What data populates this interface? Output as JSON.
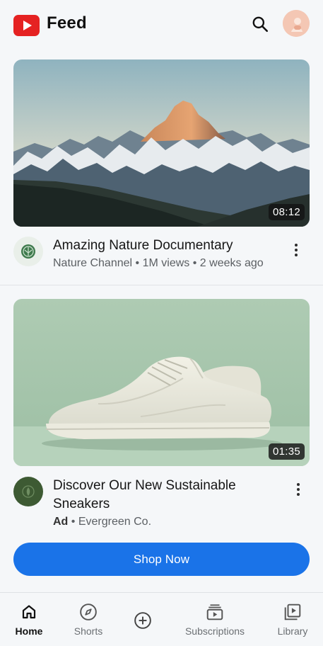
{
  "header": {
    "title": "Feed",
    "logo_icon": "youtube-play-icon",
    "search_icon": "search-icon",
    "avatar_icon": "user-avatar-icon"
  },
  "feed": [
    {
      "title": "Amazing Nature Documentary",
      "channel": "Nature Channel",
      "views": "1M views",
      "age": "2 weeks ago",
      "duration": "08:12",
      "thumbnail": "mountain-landscape"
    },
    {
      "title": "Discover Our New Sustainable Sneakers",
      "ad_label": "Ad",
      "advertiser": "Evergreen Co.",
      "duration": "01:35",
      "thumbnail": "white-sneaker",
      "cta": "Shop Now"
    }
  ],
  "separator": "•",
  "nav": [
    {
      "label": "Home",
      "icon": "home-icon",
      "active": true
    },
    {
      "label": "Shorts",
      "icon": "compass-icon",
      "active": false
    },
    {
      "label": "",
      "icon": "add-icon",
      "active": false
    },
    {
      "label": "Subscriptions",
      "icon": "subscriptions-icon",
      "active": false
    },
    {
      "label": "Library",
      "icon": "library-icon",
      "active": false
    }
  ],
  "colors": {
    "brand_red": "#e52222",
    "accent_blue": "#1a73e8",
    "background": "#f5f7f9"
  }
}
